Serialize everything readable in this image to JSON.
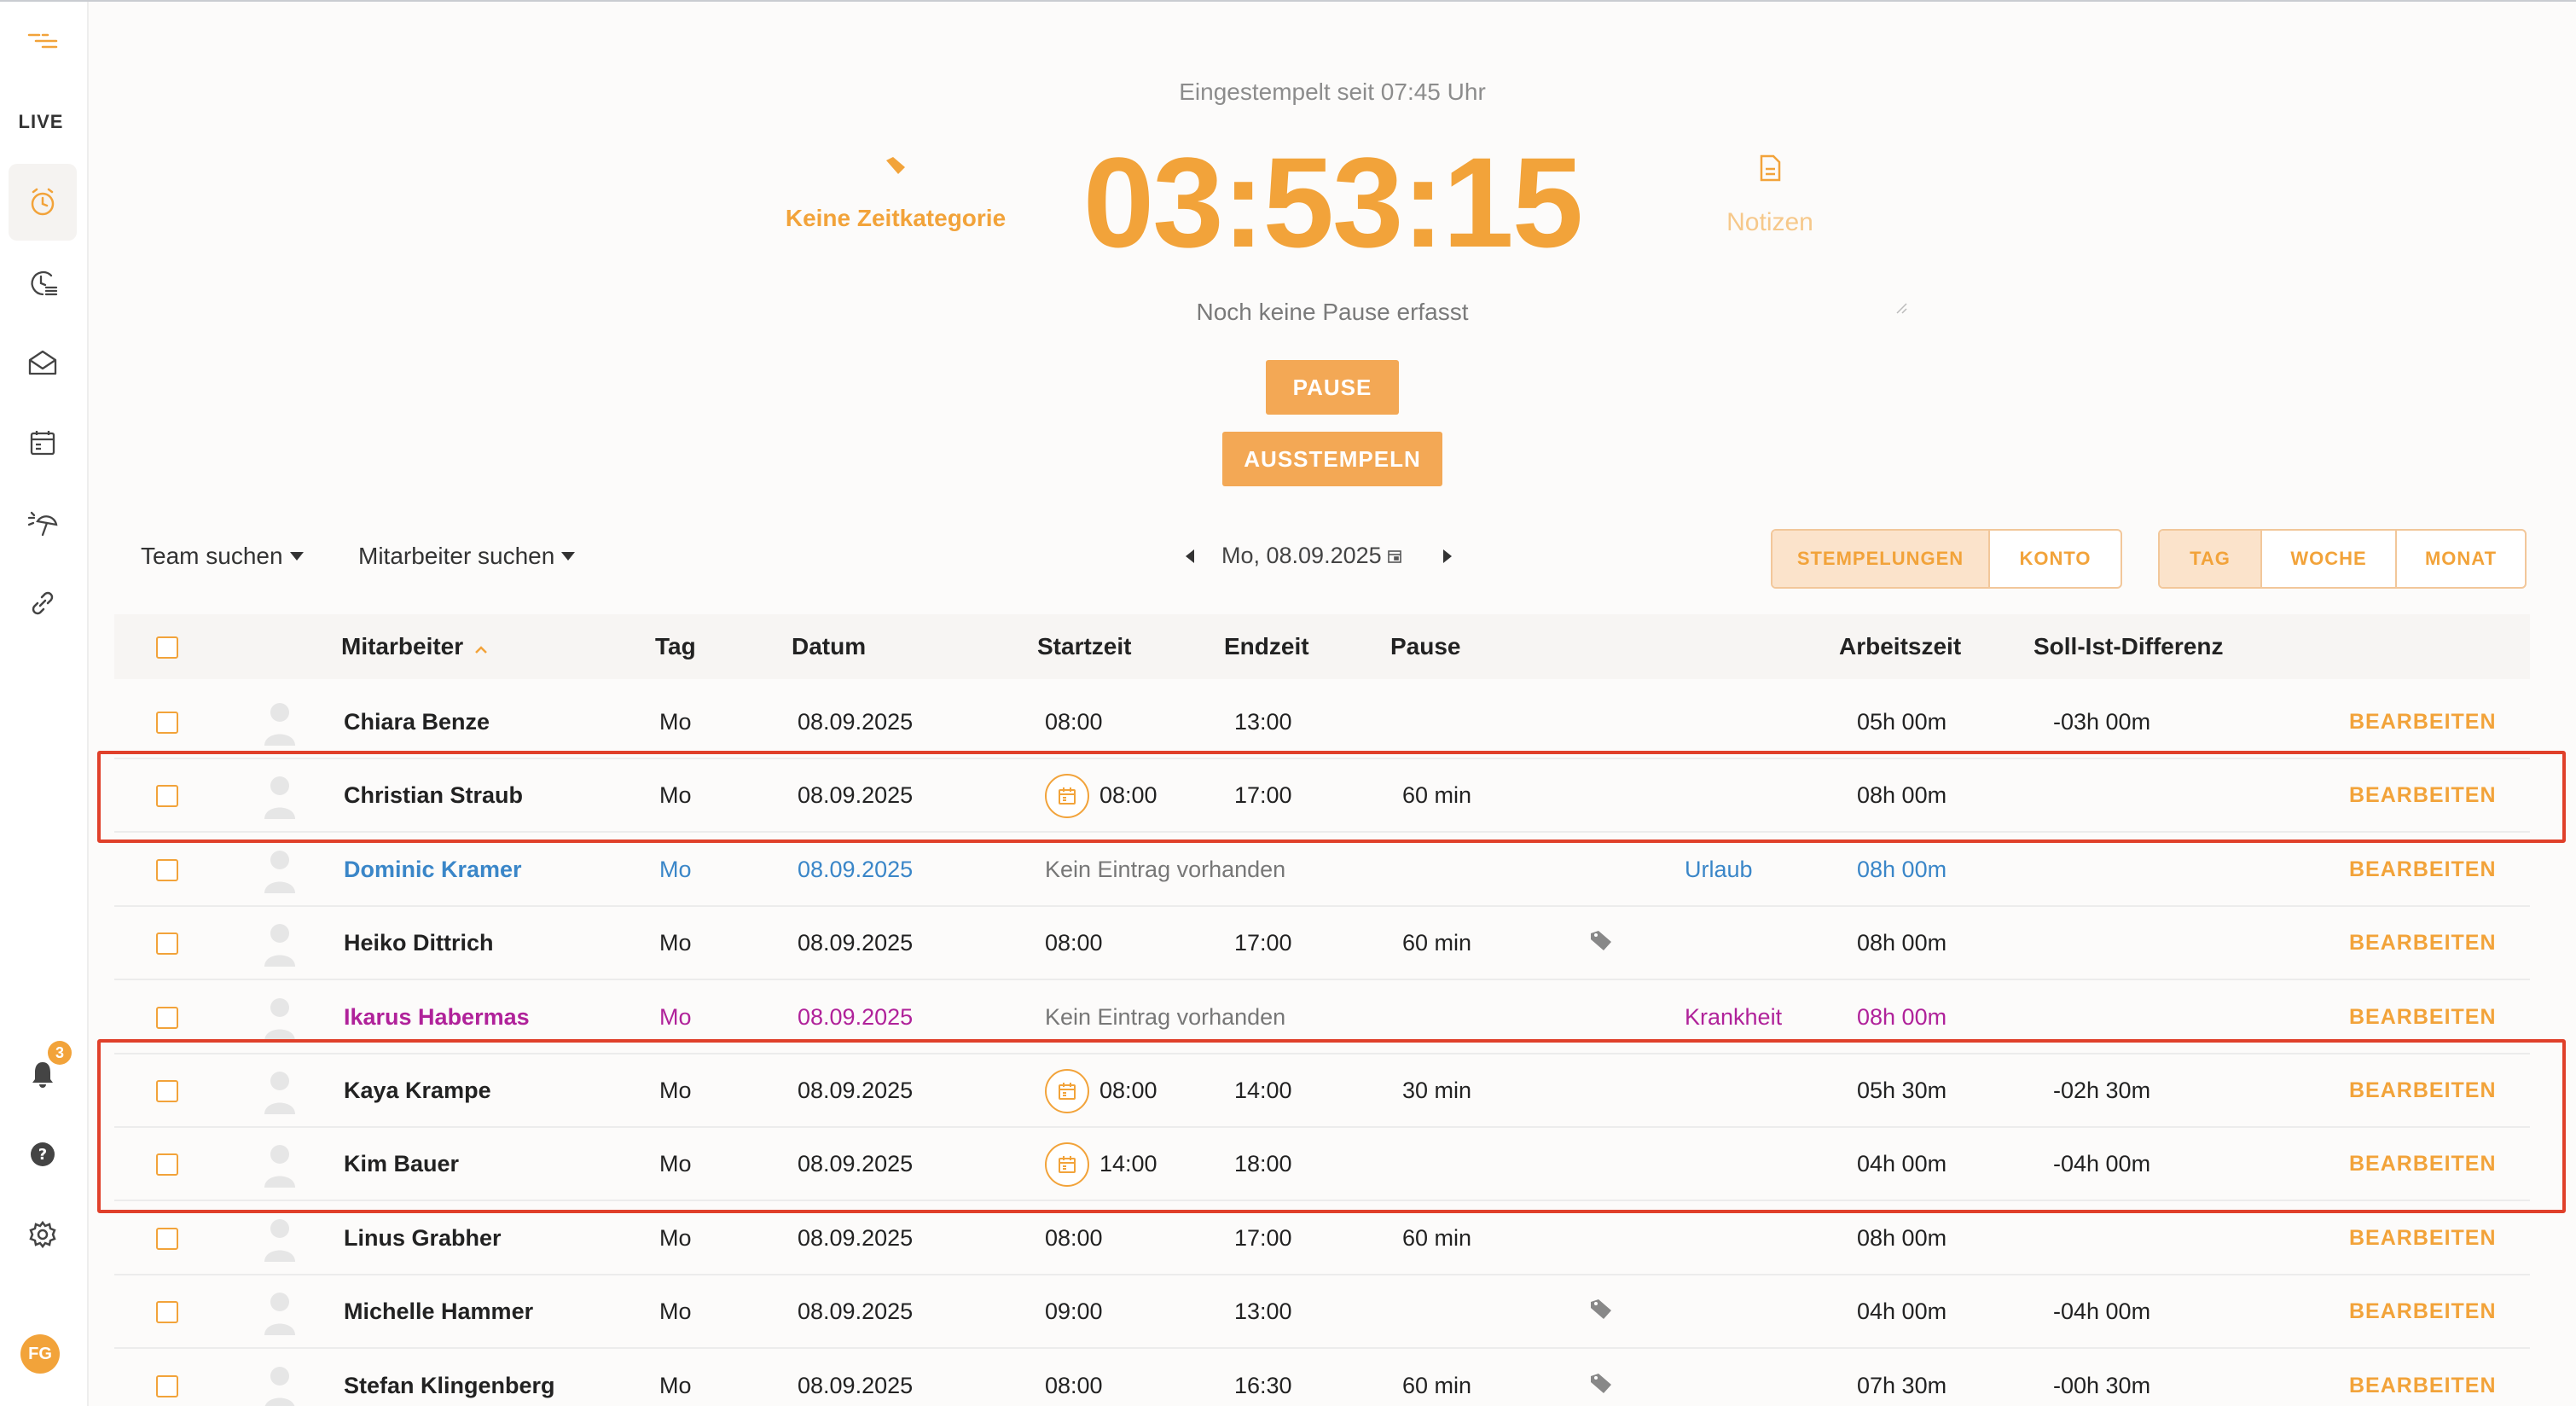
{
  "sidebar": {
    "live_label": "LIVE",
    "notification_count": "3",
    "user_initials": "FG",
    "items": [
      {
        "icon": "menu-icon"
      },
      {
        "icon": "clock-icon",
        "active": true
      },
      {
        "icon": "time-list-icon"
      },
      {
        "icon": "inbox-icon"
      },
      {
        "icon": "calendar-icon"
      },
      {
        "icon": "vacation-icon"
      },
      {
        "icon": "link-icon"
      },
      {
        "icon": "bell-icon"
      },
      {
        "icon": "help-icon"
      },
      {
        "icon": "gear-icon"
      }
    ]
  },
  "timer": {
    "clocked_since": "Eingestempelt seit 07:45 Uhr",
    "elapsed": "03:53:15",
    "category_label": "Keine Zeitkategorie",
    "notes_label": "Notizen",
    "break_status": "Noch keine Pause erfasst",
    "pause_label": "PAUSE",
    "clock_out_label": "AUSSTEMPELN"
  },
  "filters": {
    "team_label": "Team suchen",
    "employee_label": "Mitarbeiter suchen",
    "date": "Mo, 08.09.2025"
  },
  "view_toggle": {
    "mode": [
      "STEMPELUNGEN",
      "KONTO"
    ],
    "range": [
      "TAG",
      "WOCHE",
      "MONAT"
    ]
  },
  "colors": {
    "accent": "#f2a33a",
    "highlight": "#e0402a",
    "vacation": "#3a86c8",
    "sick": "#b0229a"
  },
  "table": {
    "headers": {
      "employee": "Mitarbeiter",
      "day": "Tag",
      "date": "Datum",
      "start": "Startzeit",
      "end": "Endzeit",
      "break": "Pause",
      "worktime": "Arbeitszeit",
      "difference": "Soll-Ist-Differenz"
    },
    "edit_label": "BEARBEITEN",
    "rows": [
      {
        "name": "Chiara Benze",
        "day": "Mo",
        "date": "08.09.2025",
        "start": "08:00",
        "end": "13:00",
        "break": "",
        "type": "",
        "worktime": "05h 00m",
        "diff": "-03h 00m",
        "cal": false,
        "tag": false,
        "style": ""
      },
      {
        "name": "Christian Straub",
        "day": "Mo",
        "date": "08.09.2025",
        "start": "08:00",
        "end": "17:00",
        "break": "60 min",
        "type": "",
        "worktime": "08h 00m",
        "diff": "",
        "cal": true,
        "tag": false,
        "style": ""
      },
      {
        "name": "Dominic Kramer",
        "day": "Mo",
        "date": "08.09.2025",
        "start": "Kein Eintrag vorhanden",
        "end": "",
        "break": "",
        "type": "Urlaub",
        "worktime": "08h 00m",
        "diff": "",
        "cal": false,
        "tag": false,
        "style": "blue"
      },
      {
        "name": "Heiko Dittrich",
        "day": "Mo",
        "date": "08.09.2025",
        "start": "08:00",
        "end": "17:00",
        "break": "60 min",
        "type": "",
        "worktime": "08h 00m",
        "diff": "",
        "cal": false,
        "tag": true,
        "style": ""
      },
      {
        "name": "Ikarus Habermas",
        "day": "Mo",
        "date": "08.09.2025",
        "start": "Kein Eintrag vorhanden",
        "end": "",
        "break": "",
        "type": "Krankheit",
        "worktime": "08h 00m",
        "diff": "",
        "cal": false,
        "tag": false,
        "style": "purple"
      },
      {
        "name": "Kaya Krampe",
        "day": "Mo",
        "date": "08.09.2025",
        "start": "08:00",
        "end": "14:00",
        "break": "30 min",
        "type": "",
        "worktime": "05h 30m",
        "diff": "-02h 30m",
        "cal": true,
        "tag": false,
        "style": ""
      },
      {
        "name": "Kim Bauer",
        "day": "Mo",
        "date": "08.09.2025",
        "start": "14:00",
        "end": "18:00",
        "break": "",
        "type": "",
        "worktime": "04h 00m",
        "diff": "-04h 00m",
        "cal": true,
        "tag": false,
        "style": ""
      },
      {
        "name": "Linus Grabher",
        "day": "Mo",
        "date": "08.09.2025",
        "start": "08:00",
        "end": "17:00",
        "break": "60 min",
        "type": "",
        "worktime": "08h 00m",
        "diff": "",
        "cal": false,
        "tag": false,
        "style": ""
      },
      {
        "name": "Michelle Hammer",
        "day": "Mo",
        "date": "08.09.2025",
        "start": "09:00",
        "end": "13:00",
        "break": "",
        "type": "",
        "worktime": "04h 00m",
        "diff": "-04h 00m",
        "cal": false,
        "tag": true,
        "style": ""
      },
      {
        "name": "Stefan Klingenberg",
        "day": "Mo",
        "date": "08.09.2025",
        "start": "08:00",
        "end": "16:30",
        "break": "60 min",
        "type": "",
        "worktime": "07h 30m",
        "diff": "-00h 30m",
        "cal": false,
        "tag": true,
        "style": ""
      }
    ]
  }
}
